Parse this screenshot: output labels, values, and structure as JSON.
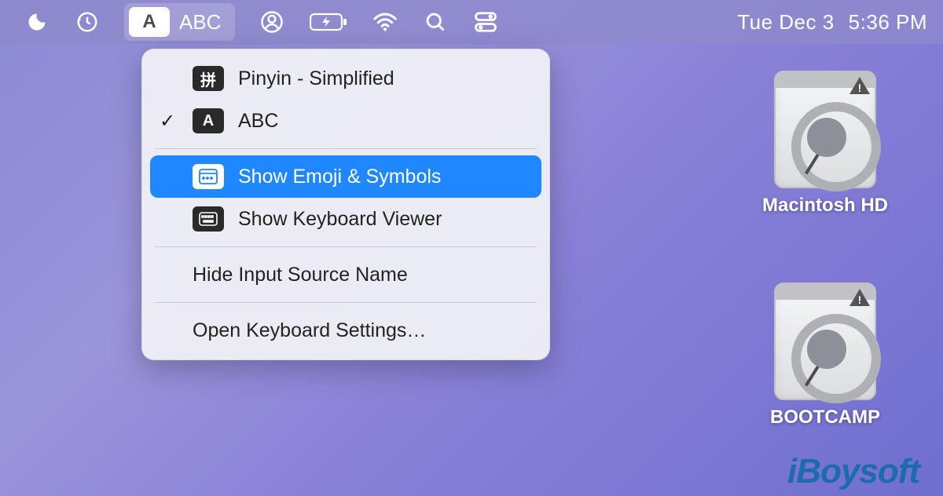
{
  "menubar": {
    "input_source": {
      "badge": "A",
      "label": "ABC"
    },
    "date": "Tue Dec 3",
    "time": "5:36 PM"
  },
  "dropdown": {
    "sources": [
      {
        "checked": false,
        "icon_text": "拼",
        "label": "Pinyin - Simplified"
      },
      {
        "checked": true,
        "icon_text": "A",
        "label": "ABC"
      }
    ],
    "viewers": [
      {
        "highlight": true,
        "label": "Show Emoji & Symbols"
      },
      {
        "highlight": false,
        "label": "Show Keyboard Viewer"
      }
    ],
    "hide_label": "Hide Input Source Name",
    "open_settings_label": "Open Keyboard Settings…"
  },
  "desktop": {
    "icons": [
      {
        "label": "Macintosh HD"
      },
      {
        "label": "BOOTCAMP"
      }
    ]
  },
  "watermark": "iBoysoft"
}
